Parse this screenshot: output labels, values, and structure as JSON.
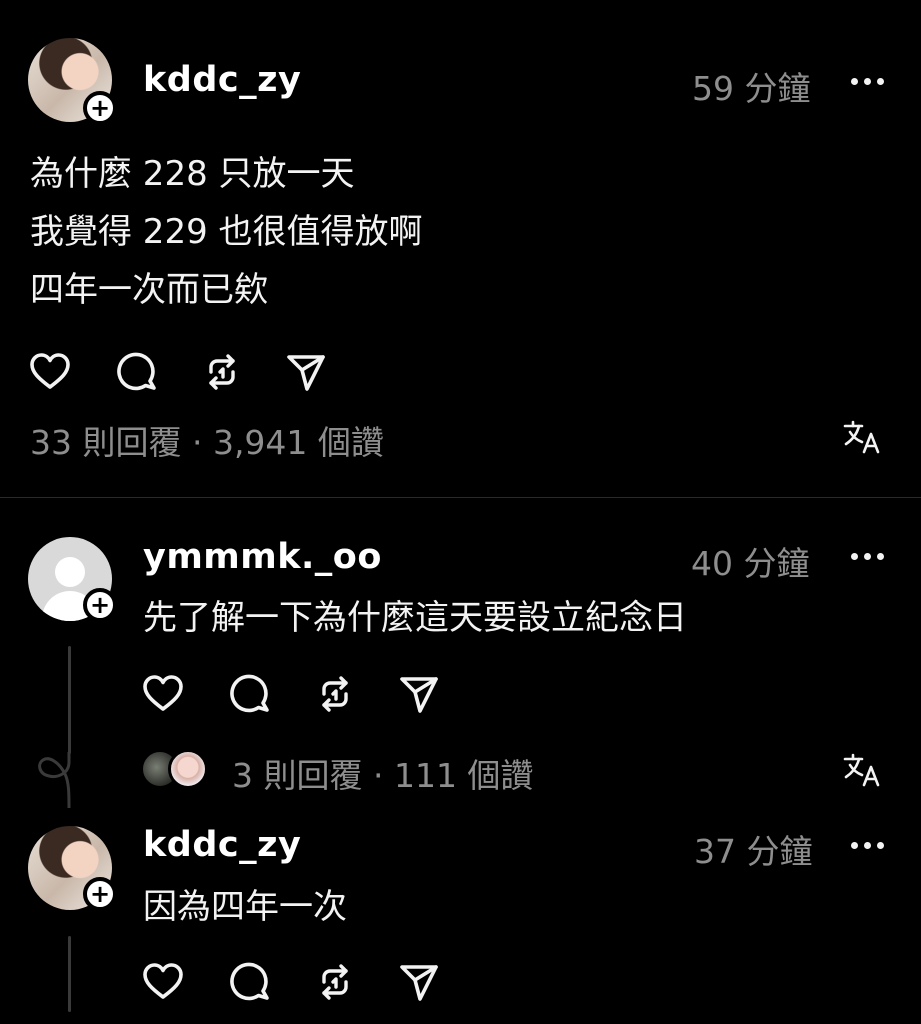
{
  "post": {
    "username": "kddc_zy",
    "time": "59 分鐘",
    "lines": [
      "為什麼 228 只放一天",
      "我覺得 229 也很值得放啊",
      "四年一次而已欸"
    ],
    "stats": "33 則回覆 · 3,941 個讚"
  },
  "reply1": {
    "username": "ymmmk._oo",
    "time": "40 分鐘",
    "text": "先了解一下為什麼這天要設立紀念日",
    "stats": "3 則回覆 · 111 個讚"
  },
  "reply2": {
    "username": "kddc_zy",
    "time": "37 分鐘",
    "text": "因為四年一次"
  },
  "icons": {
    "follow": "+",
    "like": "heart-icon",
    "comment": "comment-icon",
    "repost": "repost-icon",
    "share": "send-icon",
    "more": "more-icon",
    "translate": "translate-icon"
  },
  "colors": {
    "background": "#000000",
    "text": "#f3f3f3",
    "secondary": "#8e8e8e"
  }
}
